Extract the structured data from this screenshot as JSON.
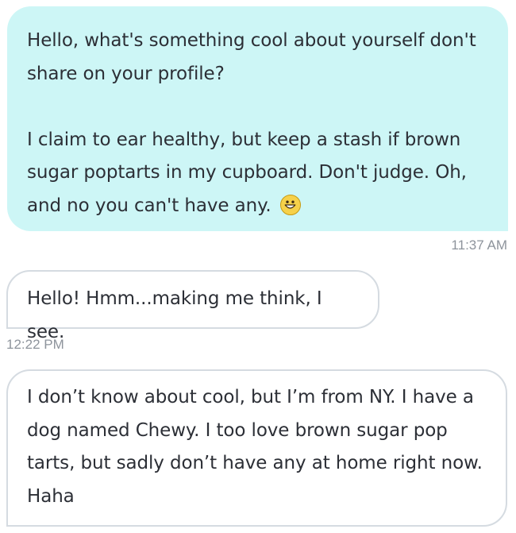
{
  "messages": [
    {
      "direction": "outgoing",
      "paragraph_1": "Hello, what's something cool about yourself don't share on your profile?",
      "paragraph_2": "I claim to ear healthy, but keep a stash if brown sugar poptarts in my cupboard. Don't judge.  Oh, and no you can't have any.",
      "emoji": "grinning-face-icon",
      "timestamp": "11:37 AM"
    },
    {
      "direction": "incoming",
      "text": "Hello!  Hmm...making me think, I see.",
      "timestamp": "12:22 PM"
    },
    {
      "direction": "incoming",
      "text": "I don’t know about cool, but I’m from NY. I have a dog named Chewy. I too love brown sugar pop tarts, but sadly don’t have any at home right now. Haha"
    }
  ],
  "colors": {
    "outgoing_bubble": "#cdf6f6",
    "incoming_border": "#d5dbe1",
    "text": "#2c2f36",
    "timestamp": "#8e949c"
  }
}
